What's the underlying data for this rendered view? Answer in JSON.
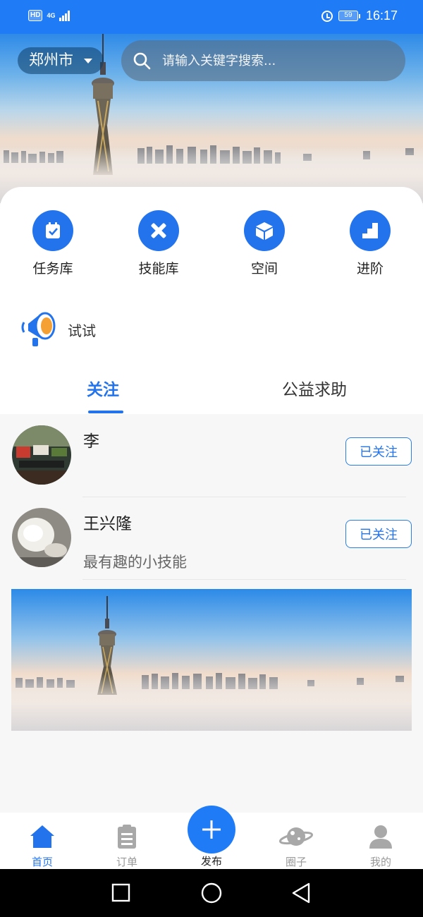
{
  "status_bar": {
    "hd": "HD",
    "network": "4G",
    "battery": "59",
    "time": "16:17"
  },
  "header": {
    "city": "郑州市",
    "search_placeholder": "请输入关键字搜索..."
  },
  "quick_actions": [
    {
      "label": "任务库",
      "icon": "task-clipboard-icon"
    },
    {
      "label": "技能库",
      "icon": "tools-icon"
    },
    {
      "label": "空间",
      "icon": "cube-icon"
    },
    {
      "label": "进阶",
      "icon": "stairs-icon"
    }
  ],
  "announcement": {
    "label": "试试",
    "icon": "megaphone-icon"
  },
  "tabs": [
    {
      "label": "关注",
      "active": true
    },
    {
      "label": "公益求助",
      "active": false
    }
  ],
  "follow_list": [
    {
      "name": "李",
      "subtitle": "",
      "button": "已关注"
    },
    {
      "name": "王兴隆",
      "subtitle": "最有趣的小技能",
      "button": "已关注"
    }
  ],
  "bottom_nav": [
    {
      "label": "首页",
      "icon": "home-icon",
      "active": true
    },
    {
      "label": "订单",
      "icon": "clipboard-icon",
      "active": false
    },
    {
      "label": "发布",
      "icon": "plus-icon",
      "active": false
    },
    {
      "label": "圈子",
      "icon": "planet-icon",
      "active": false
    },
    {
      "label": "我的",
      "icon": "user-icon",
      "active": false
    }
  ],
  "colors": {
    "primary": "#2374ec",
    "status_bar": "#1f7cf6",
    "text": "#222222",
    "muted": "#999999"
  }
}
